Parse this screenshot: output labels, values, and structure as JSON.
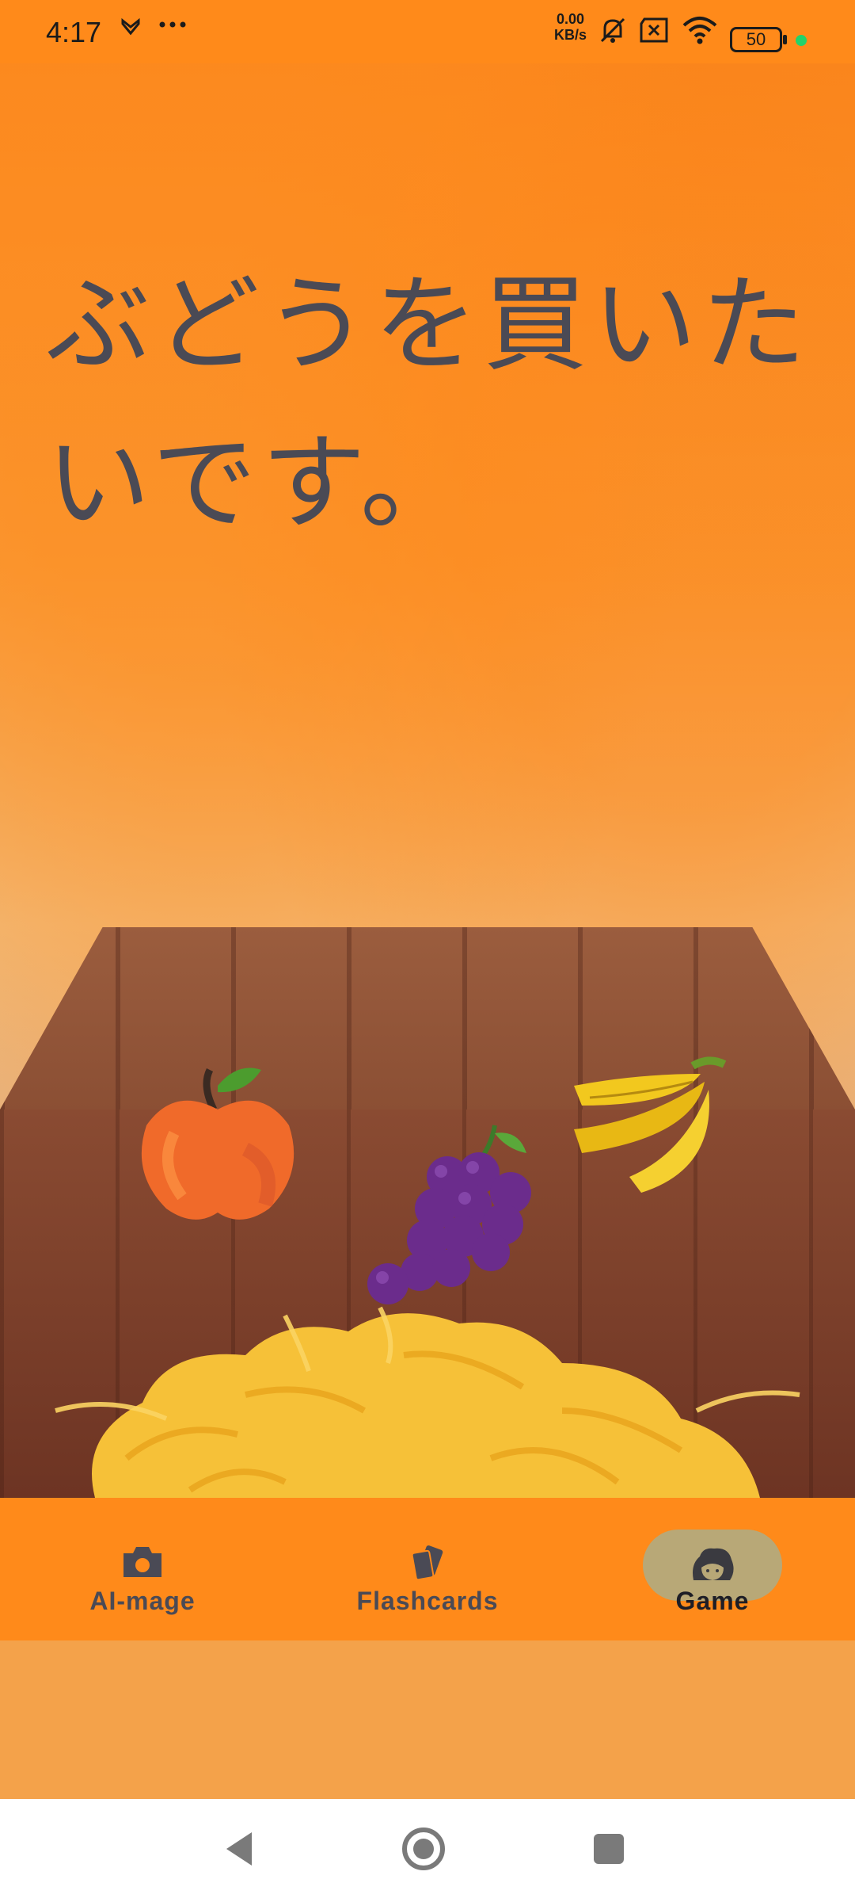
{
  "status_bar": {
    "time": "4:17",
    "net_speed_value": "0.00",
    "net_speed_unit": "KB/s",
    "battery": "50",
    "icons": [
      "notification-icon",
      "more-dots-icon",
      "mute-bell-icon",
      "no-sim-icon",
      "wifi-icon",
      "battery-icon"
    ]
  },
  "game": {
    "question": "ぶどうを買いたいです。",
    "fruits": [
      "apple",
      "grapes",
      "banana"
    ]
  },
  "bottom_nav": {
    "items": [
      {
        "label": "AI-mage",
        "icon": "camera-icon"
      },
      {
        "label": "Flashcards",
        "icon": "cards-icon"
      },
      {
        "label": "Game",
        "icon": "character-icon",
        "active": true
      }
    ]
  },
  "system_nav": {
    "icons": [
      "back-icon",
      "home-icon",
      "recents-icon"
    ]
  },
  "colors": {
    "accent": "#ff8a1a",
    "text": "#4a4a55",
    "active_pill": "#b8a877"
  }
}
